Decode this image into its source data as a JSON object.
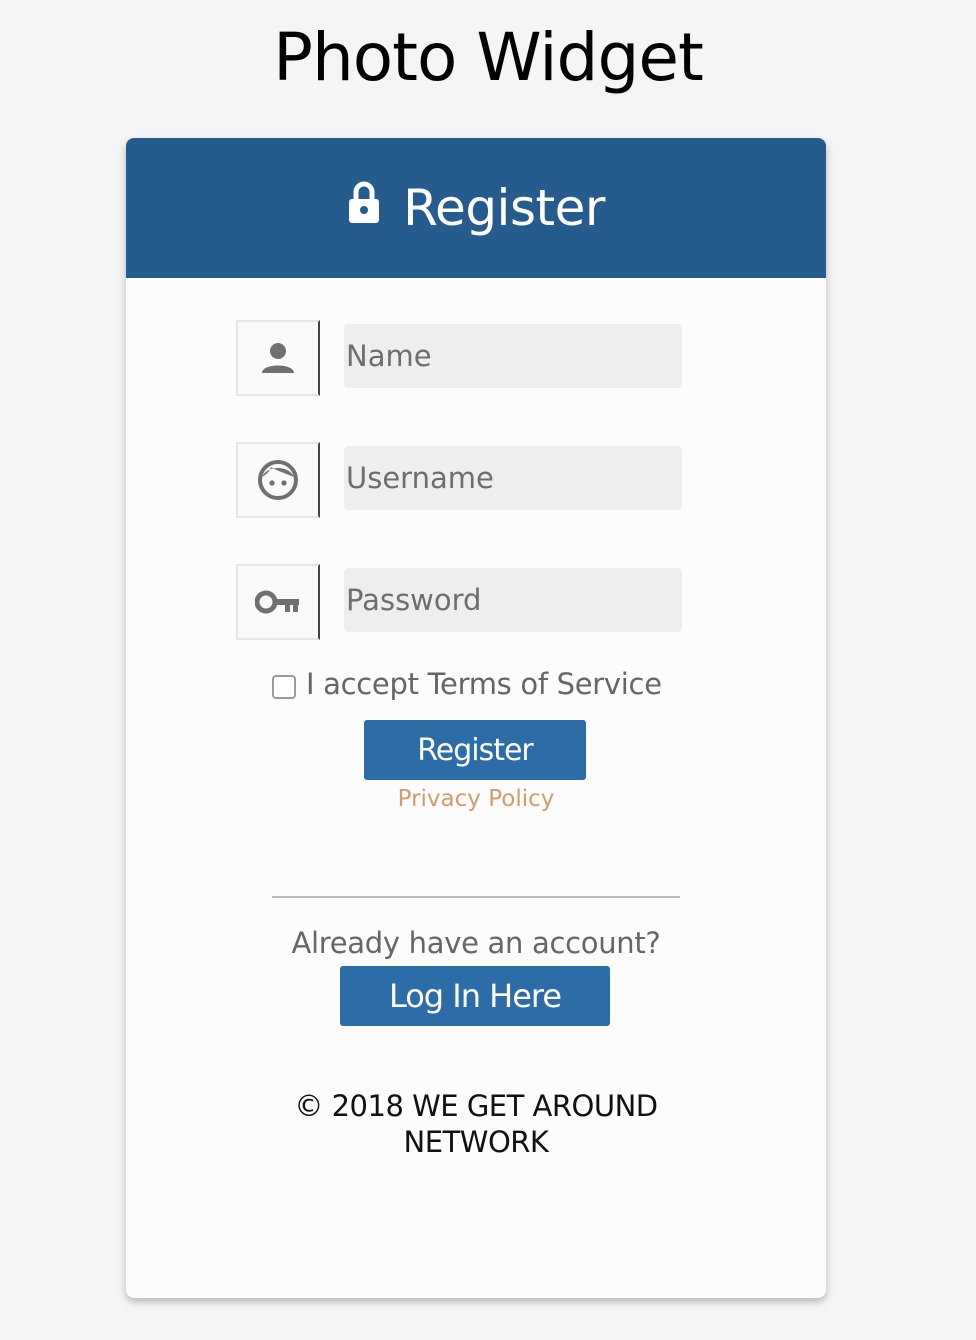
{
  "app": {
    "title": "Photo Widget"
  },
  "card": {
    "header_title": "Register",
    "header_color": "#255c8d"
  },
  "form": {
    "fields": [
      {
        "name": "name",
        "icon": "person-icon",
        "placeholder": "Name",
        "value": ""
      },
      {
        "name": "username",
        "icon": "face-icon",
        "placeholder": "Username",
        "value": ""
      },
      {
        "name": "password",
        "icon": "key-icon",
        "placeholder": "Password",
        "value": ""
      }
    ],
    "terms_label": "I accept Terms of Service",
    "terms_checked": false,
    "register_button": "Register",
    "privacy_link": "Privacy Policy"
  },
  "login": {
    "prompt": "Already have an account?",
    "button": "Log In Here"
  },
  "footer": {
    "copyright": "© 2018 WE GET AROUND NETWORK"
  },
  "colors": {
    "button": "#2c6da8",
    "link": "#d39c6b"
  }
}
